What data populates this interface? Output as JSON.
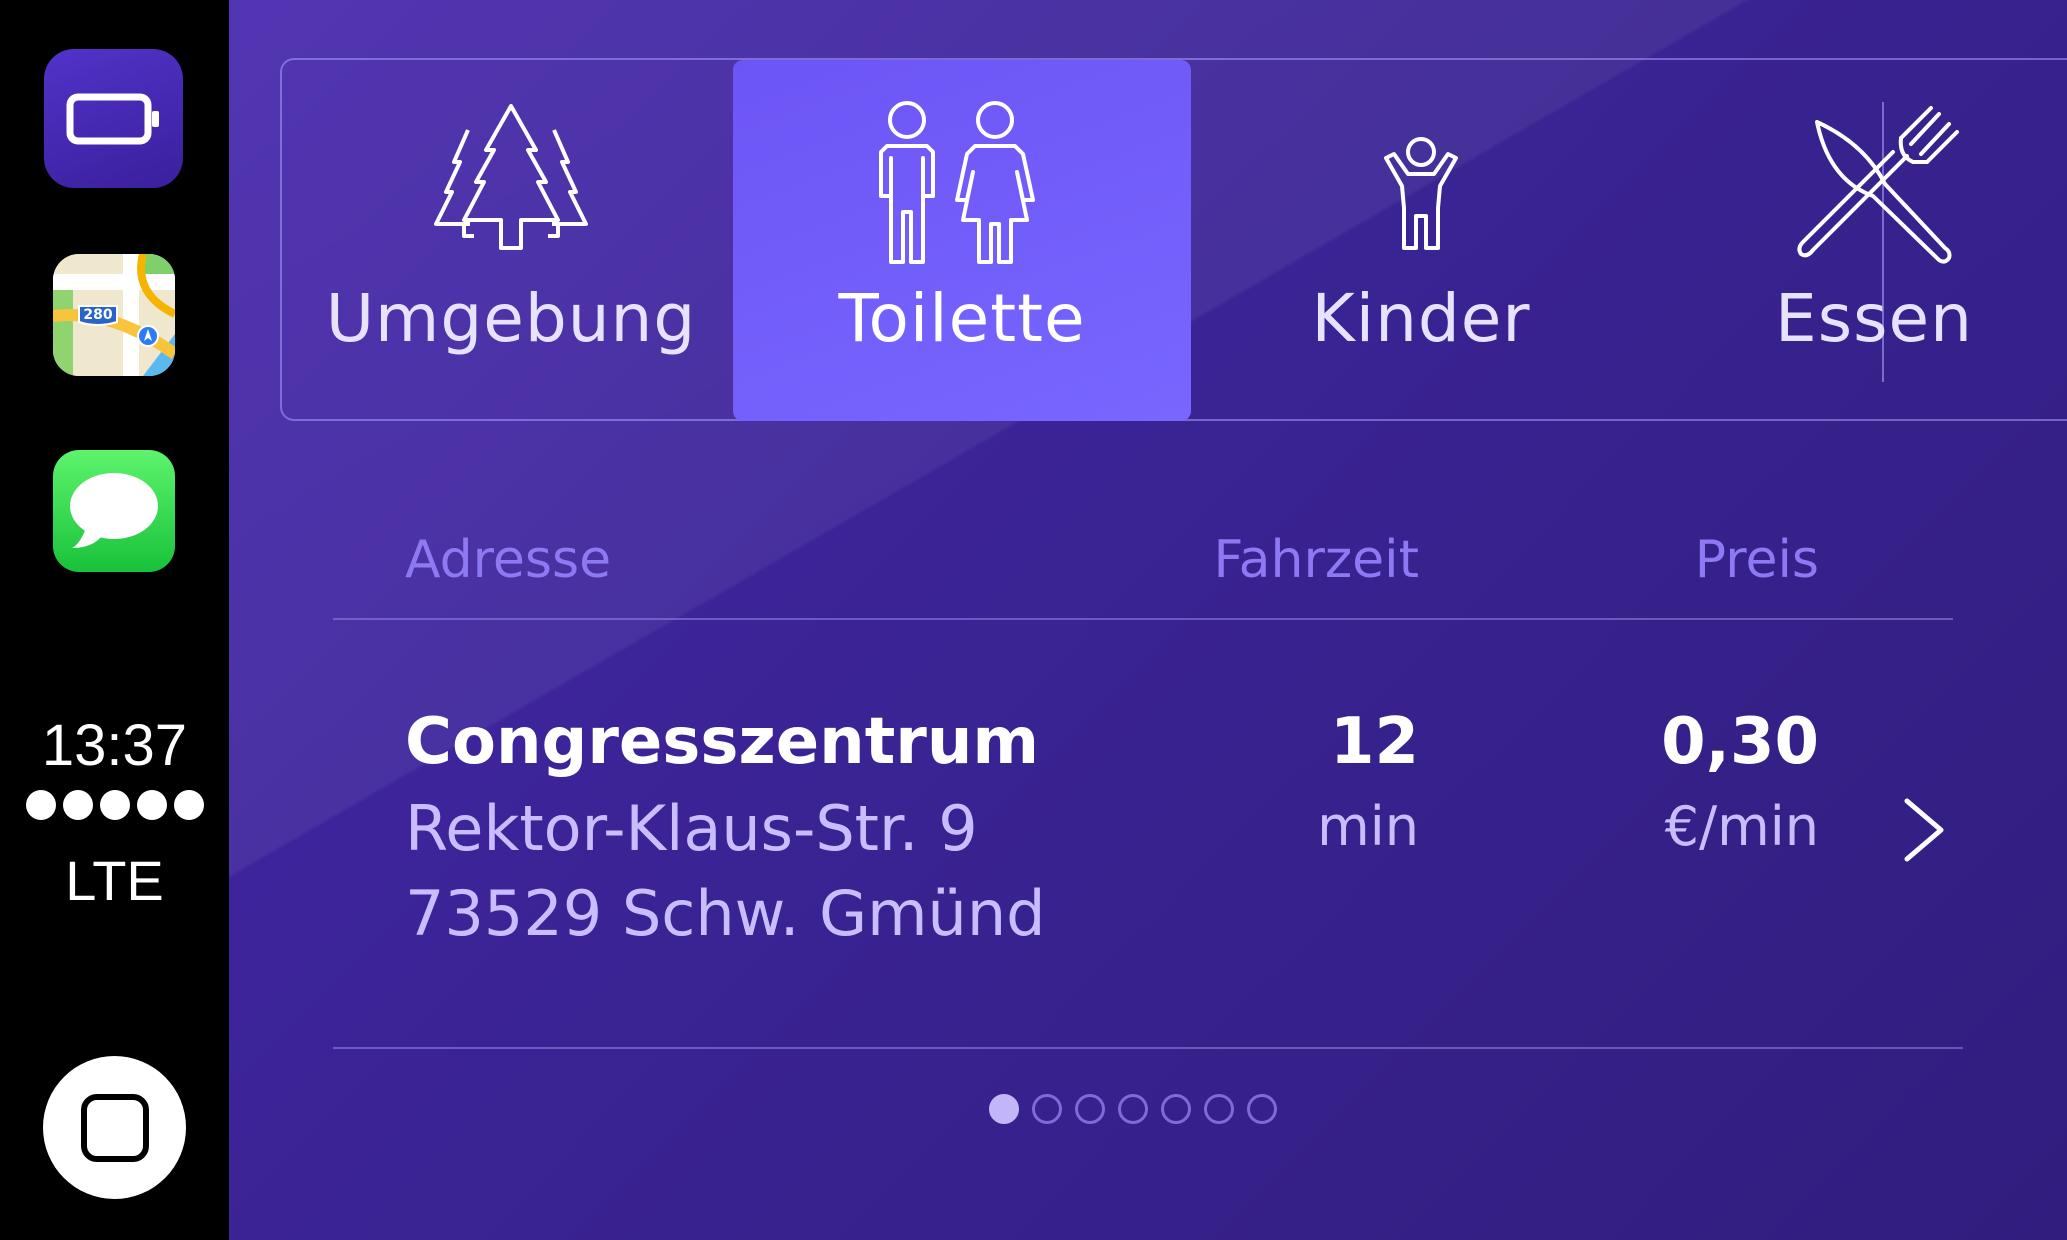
{
  "rail": {
    "apps": [
      {
        "name": "battery-app",
        "icon": "battery-icon"
      },
      {
        "name": "maps-app",
        "icon": "maps-icon",
        "badge": "280"
      },
      {
        "name": "messages-app",
        "icon": "speech-bubble-icon"
      }
    ],
    "clock": "13:37",
    "signal_bars": 5,
    "network": "LTE"
  },
  "tabs": [
    {
      "label": "Umgebung",
      "icon": "trees-icon",
      "active": false
    },
    {
      "label": "Toilette",
      "icon": "restroom-icon",
      "active": true
    },
    {
      "label": "Kinder",
      "icon": "child-icon",
      "active": false
    },
    {
      "label": "Essen",
      "icon": "knife-fork-icon",
      "active": false
    }
  ],
  "table": {
    "headers": {
      "address": "Adresse",
      "time": "Fahrzeit",
      "price": "Preis"
    },
    "rows": [
      {
        "name": "Congresszentrum",
        "street": "Rektor-Klaus-Str. 9",
        "city": "73529 Schw. Gmünd",
        "time": "12",
        "time_unit": "min",
        "price": "0,30",
        "price_unit": "€/min"
      }
    ]
  },
  "pager": {
    "total": 7,
    "current": 1
  },
  "colors": {
    "background": "#3a2393",
    "active_tab": "#6c55f5",
    "header_text": "#8f79f2",
    "secondary_text": "#c9bdff"
  }
}
